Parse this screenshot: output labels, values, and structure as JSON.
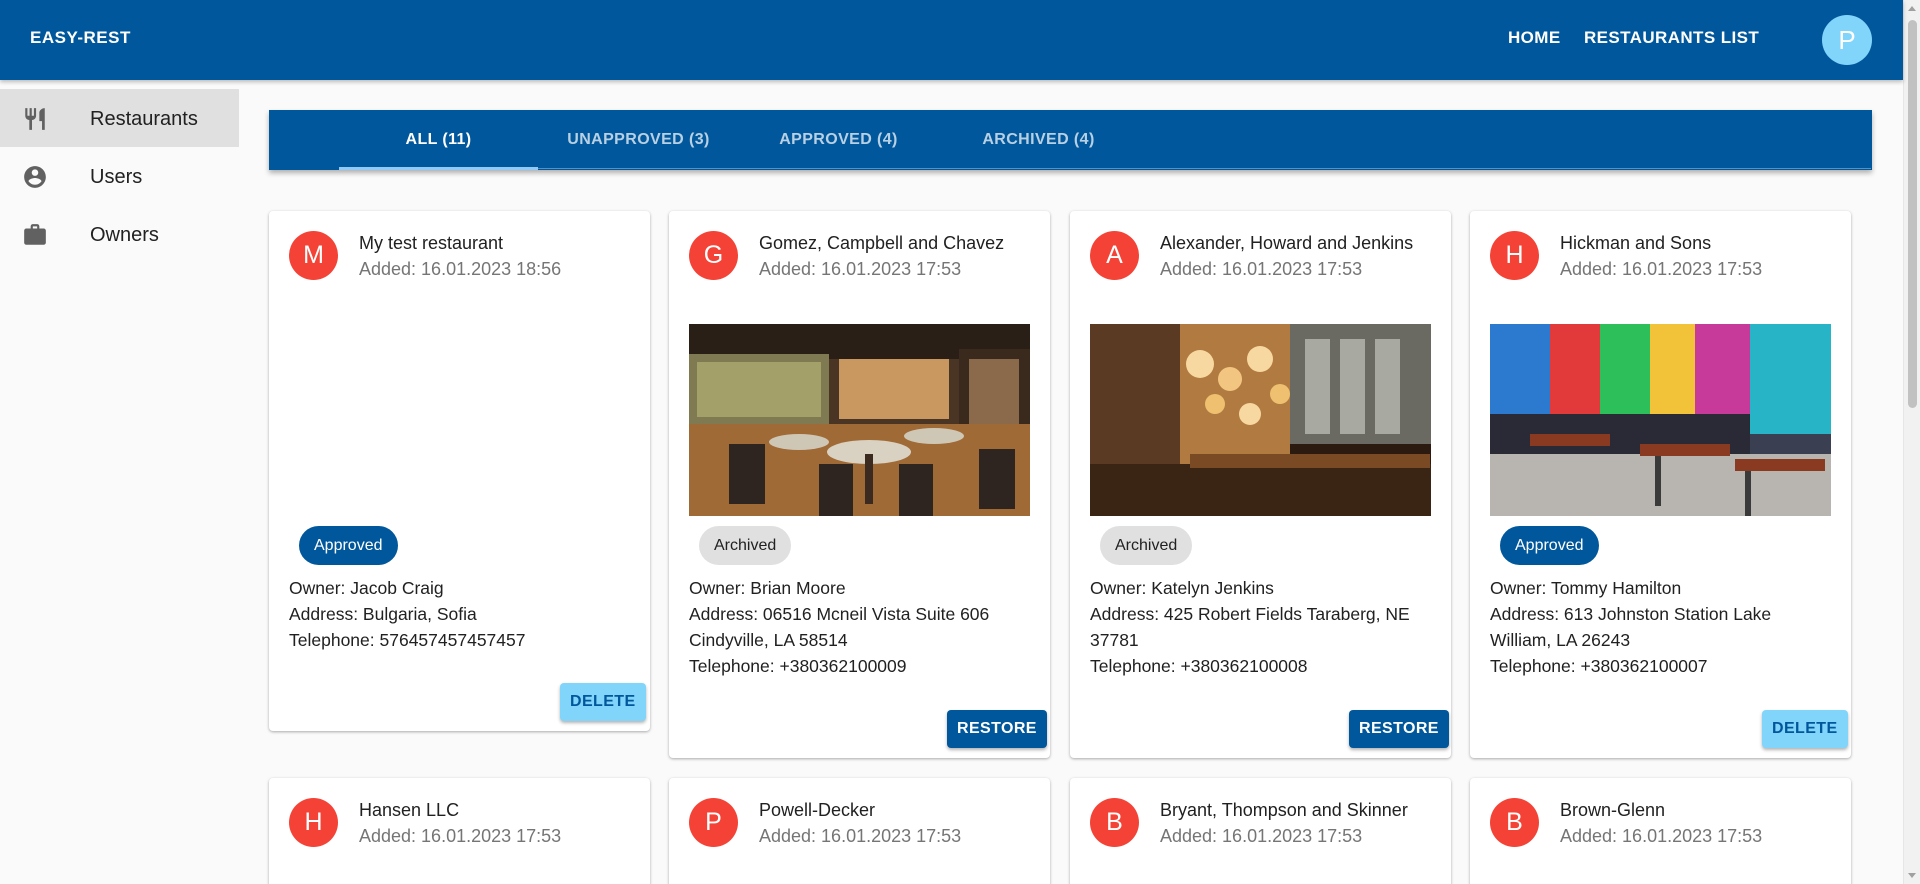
{
  "header": {
    "brand": "EASY-REST",
    "nav": [
      "HOME",
      "RESTAURANTS LIST"
    ],
    "avatar_letter": "P",
    "color": "#01579b"
  },
  "sidebar": {
    "items": [
      {
        "label": "Restaurants",
        "icon": "fork-knife-icon",
        "active": true
      },
      {
        "label": "Users",
        "icon": "account-circle-icon",
        "active": false
      },
      {
        "label": "Owners",
        "icon": "briefcase-icon",
        "active": false
      }
    ]
  },
  "tabs": [
    {
      "label": "ALL (11)",
      "active": true
    },
    {
      "label": "UNAPPROVED (3)",
      "active": false
    },
    {
      "label": "APPROVED (4)",
      "active": false
    },
    {
      "label": "ARCHIVED (4)",
      "active": false
    }
  ],
  "restaurants": [
    {
      "letter": "M",
      "name": "My test restaurant",
      "added": "Added: 16.01.2023 18:56",
      "has_photo": false,
      "status": "Approved",
      "owner": "Owner: Jacob Craig",
      "address": "Address: Bulgaria, Sofia",
      "telephone": "Telephone: 576457457457457",
      "action": "DELETE"
    },
    {
      "letter": "G",
      "name": "Gomez, Campbell and Chavez",
      "added": "Added: 16.01.2023 17:53",
      "has_photo": true,
      "photo": "restaurant-interior-photo",
      "status": "Archived",
      "owner": "Owner: Brian Moore",
      "address": "Address: 06516 Mcneil Vista Suite 606 Cindyville, LA 58514",
      "telephone": "Telephone: +380362100009",
      "action": "RESTORE"
    },
    {
      "letter": "A",
      "name": "Alexander, Howard and Jenkins",
      "added": "Added: 16.01.2023 17:53",
      "has_photo": true,
      "photo": "restaurant-interior-photo",
      "status": "Archived",
      "owner": "Owner: Katelyn Jenkins",
      "address": "Address: 425 Robert Fields Taraberg, NE 37781",
      "telephone": "Telephone: +380362100008",
      "action": "RESTORE"
    },
    {
      "letter": "H",
      "name": "Hickman and Sons",
      "added": "Added: 16.01.2023 17:53",
      "has_photo": true,
      "photo": "restaurant-interior-photo",
      "status": "Approved",
      "owner": "Owner: Tommy Hamilton",
      "address": "Address: 613 Johnston Station Lake William, LA 26243",
      "telephone": "Telephone: +380362100007",
      "action": "DELETE"
    },
    {
      "letter": "H",
      "name": "Hansen LLC",
      "added": "Added: 16.01.2023 17:53"
    },
    {
      "letter": "P",
      "name": "Powell-Decker",
      "added": "Added: 16.01.2023 17:53"
    },
    {
      "letter": "B",
      "name": "Bryant, Thompson and Skinner",
      "added": "Added: 16.01.2023 17:53"
    },
    {
      "letter": "B",
      "name": "Brown-Glenn",
      "added": "Added: 16.01.2023 17:53"
    }
  ]
}
